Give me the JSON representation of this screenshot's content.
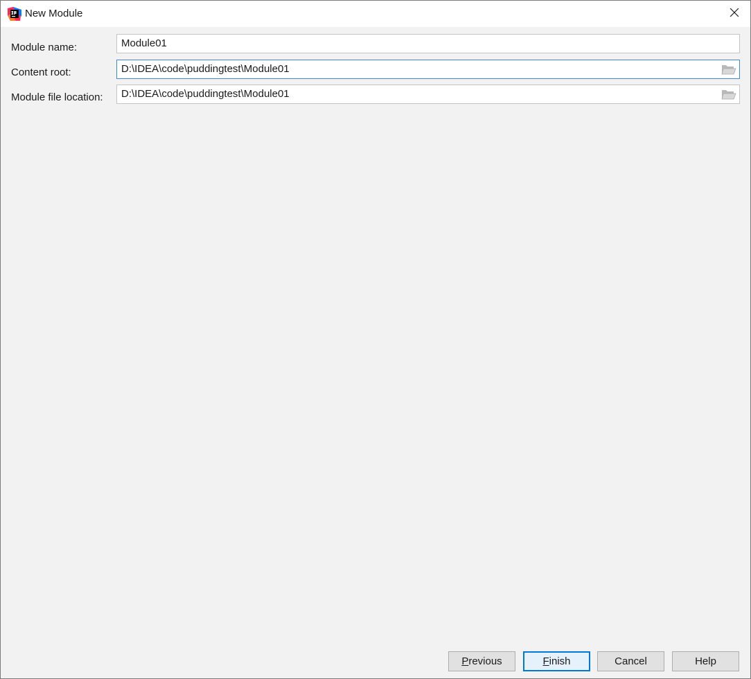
{
  "window": {
    "title": "New Module",
    "app_icon": "intellij-idea-icon",
    "close_icon": "close-icon"
  },
  "form": {
    "module_name": {
      "label": "Module name:",
      "value": "Module01"
    },
    "content_root": {
      "label": "Content root:",
      "value": "D:\\IDEA\\code\\puddingtest\\Module01",
      "browse_icon": "folder-open-icon"
    },
    "module_file_location": {
      "label": "Module file location:",
      "value": "D:\\IDEA\\code\\puddingtest\\Module01",
      "browse_icon": "folder-open-icon"
    }
  },
  "buttons": {
    "previous": {
      "first": "P",
      "rest": "revious"
    },
    "finish": {
      "first": "F",
      "rest": "inish"
    },
    "cancel": "Cancel",
    "help": "Help"
  },
  "colors": {
    "focus_border": "#3d89d6",
    "default_button_border": "#0078d7",
    "dialog_background": "#f2f2f2"
  }
}
